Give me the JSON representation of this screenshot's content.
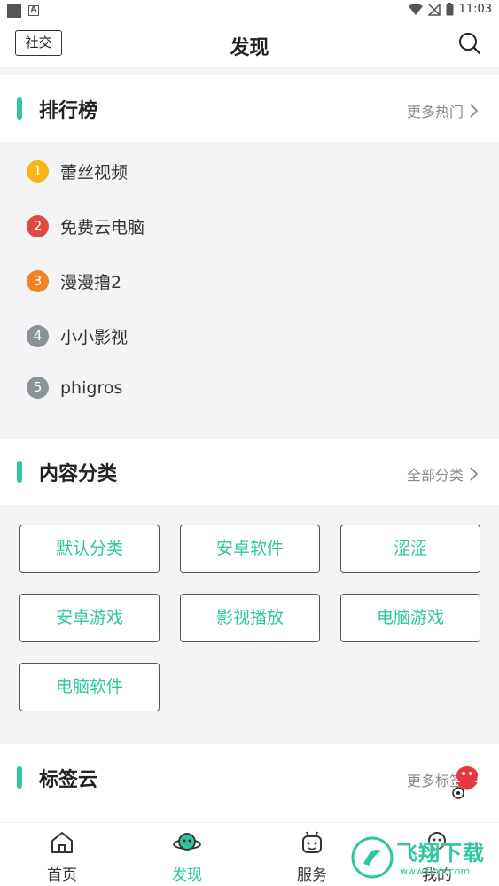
{
  "status_bar": {
    "time": "11:03"
  },
  "header": {
    "title": "发现",
    "social_label": "社交"
  },
  "ranking": {
    "title": "排行榜",
    "more_label": "更多热门",
    "items": [
      {
        "rank": "1",
        "name": "蕾丝视频",
        "color": "#f7b519"
      },
      {
        "rank": "2",
        "name": "免费云电脑",
        "color": "#e04a45"
      },
      {
        "rank": "3",
        "name": "漫漫撸2",
        "color": "#f08426"
      },
      {
        "rank": "4",
        "name": "小小影视",
        "color": "#8a9398"
      },
      {
        "rank": "5",
        "name": "phigros",
        "color": "#8a9398"
      }
    ]
  },
  "categories": {
    "title": "内容分类",
    "more_label": "全部分类",
    "items": [
      "默认分类",
      "安卓软件",
      "涩涩",
      "安卓游戏",
      "影视播放",
      "电脑游戏",
      "电脑软件"
    ]
  },
  "tags": {
    "title": "标签云",
    "more_label": "更多标签"
  },
  "tabs": [
    {
      "label": "首页",
      "icon": "home-icon"
    },
    {
      "label": "发现",
      "icon": "discover-icon",
      "active": true
    },
    {
      "label": "服务",
      "icon": "service-icon"
    },
    {
      "label": "我的",
      "icon": "profile-icon"
    }
  ],
  "watermark": {
    "text": "飞翔下载",
    "sub": "www.fxxz.com"
  },
  "colors": {
    "accent": "#2ec7a1"
  }
}
